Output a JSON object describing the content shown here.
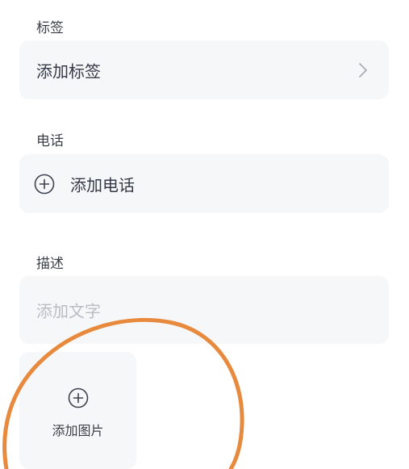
{
  "tags": {
    "label": "标签",
    "value": "添加标签"
  },
  "phone": {
    "label": "电话",
    "action": "添加电话"
  },
  "description": {
    "label": "描述",
    "placeholder": "添加文字"
  },
  "image": {
    "action": "添加图片"
  },
  "icons": {
    "chevron": "chevron-right-icon",
    "plus": "plus-circle-icon"
  },
  "colors": {
    "field_background": "#f6f7f9",
    "text": "#343946",
    "placeholder": "#b8bcc4",
    "annotation_circle": "#e88a3e"
  }
}
